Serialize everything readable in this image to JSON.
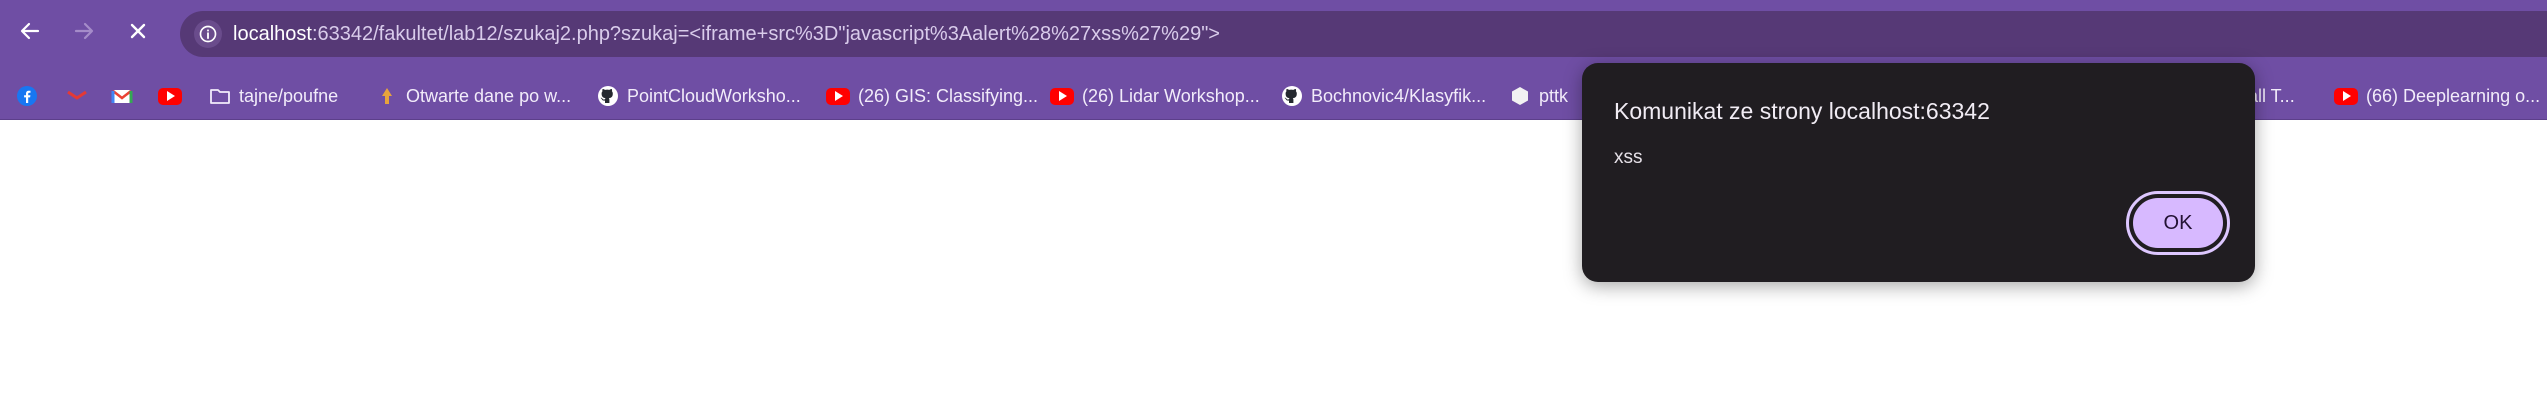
{
  "browser": {
    "address_host": "localhost",
    "address_rest": ":63342/fakultet/lab12/szukaj2.php?szukaj=<iframe+src%3D\"javascript%3Aalert%28%27xss%27%29\">"
  },
  "bookmarks": [
    {
      "label": "",
      "icon": "facebook-icon"
    },
    {
      "label": "",
      "icon": "mail-icon"
    },
    {
      "label": "",
      "icon": "gmail-icon"
    },
    {
      "label": "",
      "icon": "youtube-icon"
    },
    {
      "label": "tajne/poufne",
      "icon": "folder-icon"
    },
    {
      "label": "Otwarte dane po w...",
      "icon": "site-icon"
    },
    {
      "label": "PointCloudWorksho...",
      "icon": "github-icon"
    },
    {
      "label": "(26) GIS: Classifying...",
      "icon": "youtube-icon"
    },
    {
      "label": "(26) Lidar Workshop...",
      "icon": "youtube-icon"
    },
    {
      "label": "Bochnovic4/Klasyfik...",
      "icon": "github-icon"
    },
    {
      "label": "pttk",
      "icon": "hexagon-icon"
    },
    {
      "label": "stall T...",
      "icon": ""
    },
    {
      "label": "(66) Deeplearning o...",
      "icon": "youtube-icon"
    }
  ],
  "dialog": {
    "title": "Komunikat ze strony localhost:63342",
    "message": "xss",
    "ok_label": "OK"
  },
  "colors": {
    "toolbar": "#6f4ea4",
    "omnibox": "#563976",
    "dialog_bg": "#201d21",
    "ok_button": "#d7b9ff"
  }
}
